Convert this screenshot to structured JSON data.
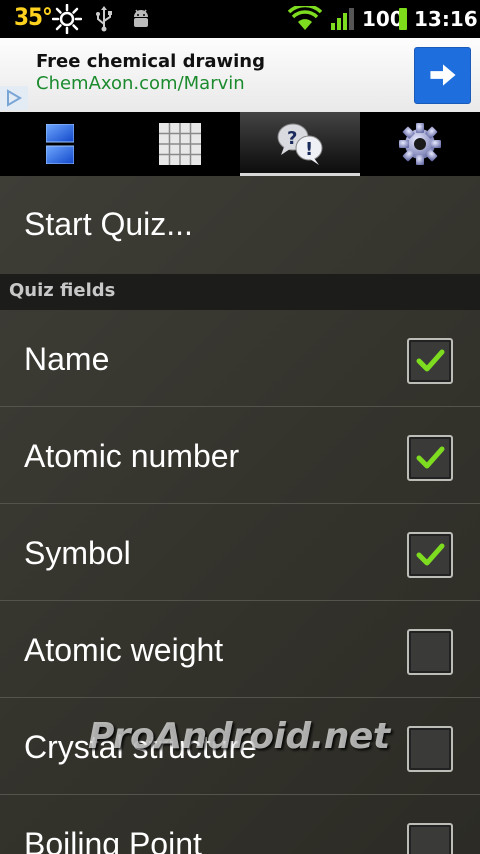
{
  "status_bar": {
    "temperature": "35°",
    "icons": [
      "sun-icon",
      "usb-icon",
      "android-debug-icon",
      "wifi-icon",
      "signal-icon"
    ],
    "battery": "100",
    "time": "13:16"
  },
  "ad": {
    "title": "Free chemical drawing",
    "url": "ChemAxon.com/Marvin",
    "button_icon": "arrow-right-icon"
  },
  "tabs": [
    {
      "icon": "element-card-icon",
      "active": false
    },
    {
      "icon": "periodic-table-grid-icon",
      "active": false
    },
    {
      "icon": "quiz-bubbles-icon",
      "active": true
    },
    {
      "icon": "gear-icon",
      "active": false
    }
  ],
  "start_quiz_label": "Start Quiz...",
  "section_title": "Quiz fields",
  "fields": [
    {
      "label": "Name",
      "checked": true
    },
    {
      "label": "Atomic number",
      "checked": true
    },
    {
      "label": "Symbol",
      "checked": true
    },
    {
      "label": "Atomic weight",
      "checked": false
    },
    {
      "label": "Crystal structure",
      "checked": false
    },
    {
      "label": "Boiling Point",
      "checked": false
    }
  ],
  "watermark": "ProAndroid.net",
  "colors": {
    "check_green": "#7edc20",
    "battery_green": "#7ddd1a",
    "temp_yellow": "#ffd21f",
    "ad_button_blue": "#1e6fdd",
    "ad_url_green": "#1c8b2e"
  }
}
